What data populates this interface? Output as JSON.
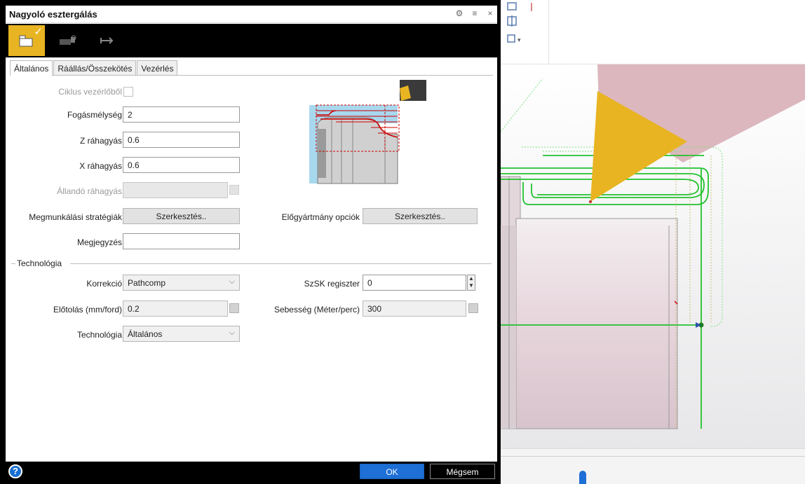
{
  "dialog": {
    "title": "Nagyoló esztergálás",
    "title_icons": [
      "settings-gear-icon",
      "menu-icon",
      "close-icon"
    ]
  },
  "toolbar": {
    "buttons": [
      {
        "icon": "operation-profile-icon",
        "active": true
      },
      {
        "icon": "tool-icon",
        "active": false
      },
      {
        "icon": "arrows-icon",
        "active": false
      }
    ],
    "accent_color": "#e8b422"
  },
  "tabs": [
    "Általános",
    "Ráállás/Összekötés",
    "Vezérlés"
  ],
  "general": {
    "ciklus_label": "Ciklus vezérlőből",
    "fogas_label": "Fogásmélység",
    "fogas_value": "2",
    "z_label": "Z ráhagyás",
    "z_value": "0.6",
    "x_label": "X ráhagyás",
    "x_value": "0.6",
    "allando_label": "Állandó ráhagyás",
    "allando_value": "",
    "strategia_label": "Megmunkálási stratégiák",
    "strategia_button": "Szerkesztés..",
    "elogyartmany_label": "Előgyártmány opciók",
    "elogyartmany_button": "Szerkesztés..",
    "megjegyzes_label": "Megjegyzés",
    "megjegyzes_value": ""
  },
  "technology": {
    "section_label": "Technológia",
    "korrekcio_label": "Korrekció",
    "korrekcio_value": "Pathcomp",
    "szsk_label": "SzSK regiszter",
    "szsk_value": "0",
    "elotolas_label": "Előtolás (mm/ford)",
    "elotolas_value": "0.2",
    "sebesseg_label": "Sebesség (Méter/perc)",
    "sebesseg_value": "300",
    "technologia_label": "Technológia",
    "technologia_value": "Általános"
  },
  "footer": {
    "help_label": "?",
    "ok_label": "OK",
    "cancel_label": "Mégsem",
    "ok_color": "#1e6fd6"
  },
  "cad": {
    "toolpath_color": "#22c22e",
    "tool_color": "#e8b422"
  }
}
